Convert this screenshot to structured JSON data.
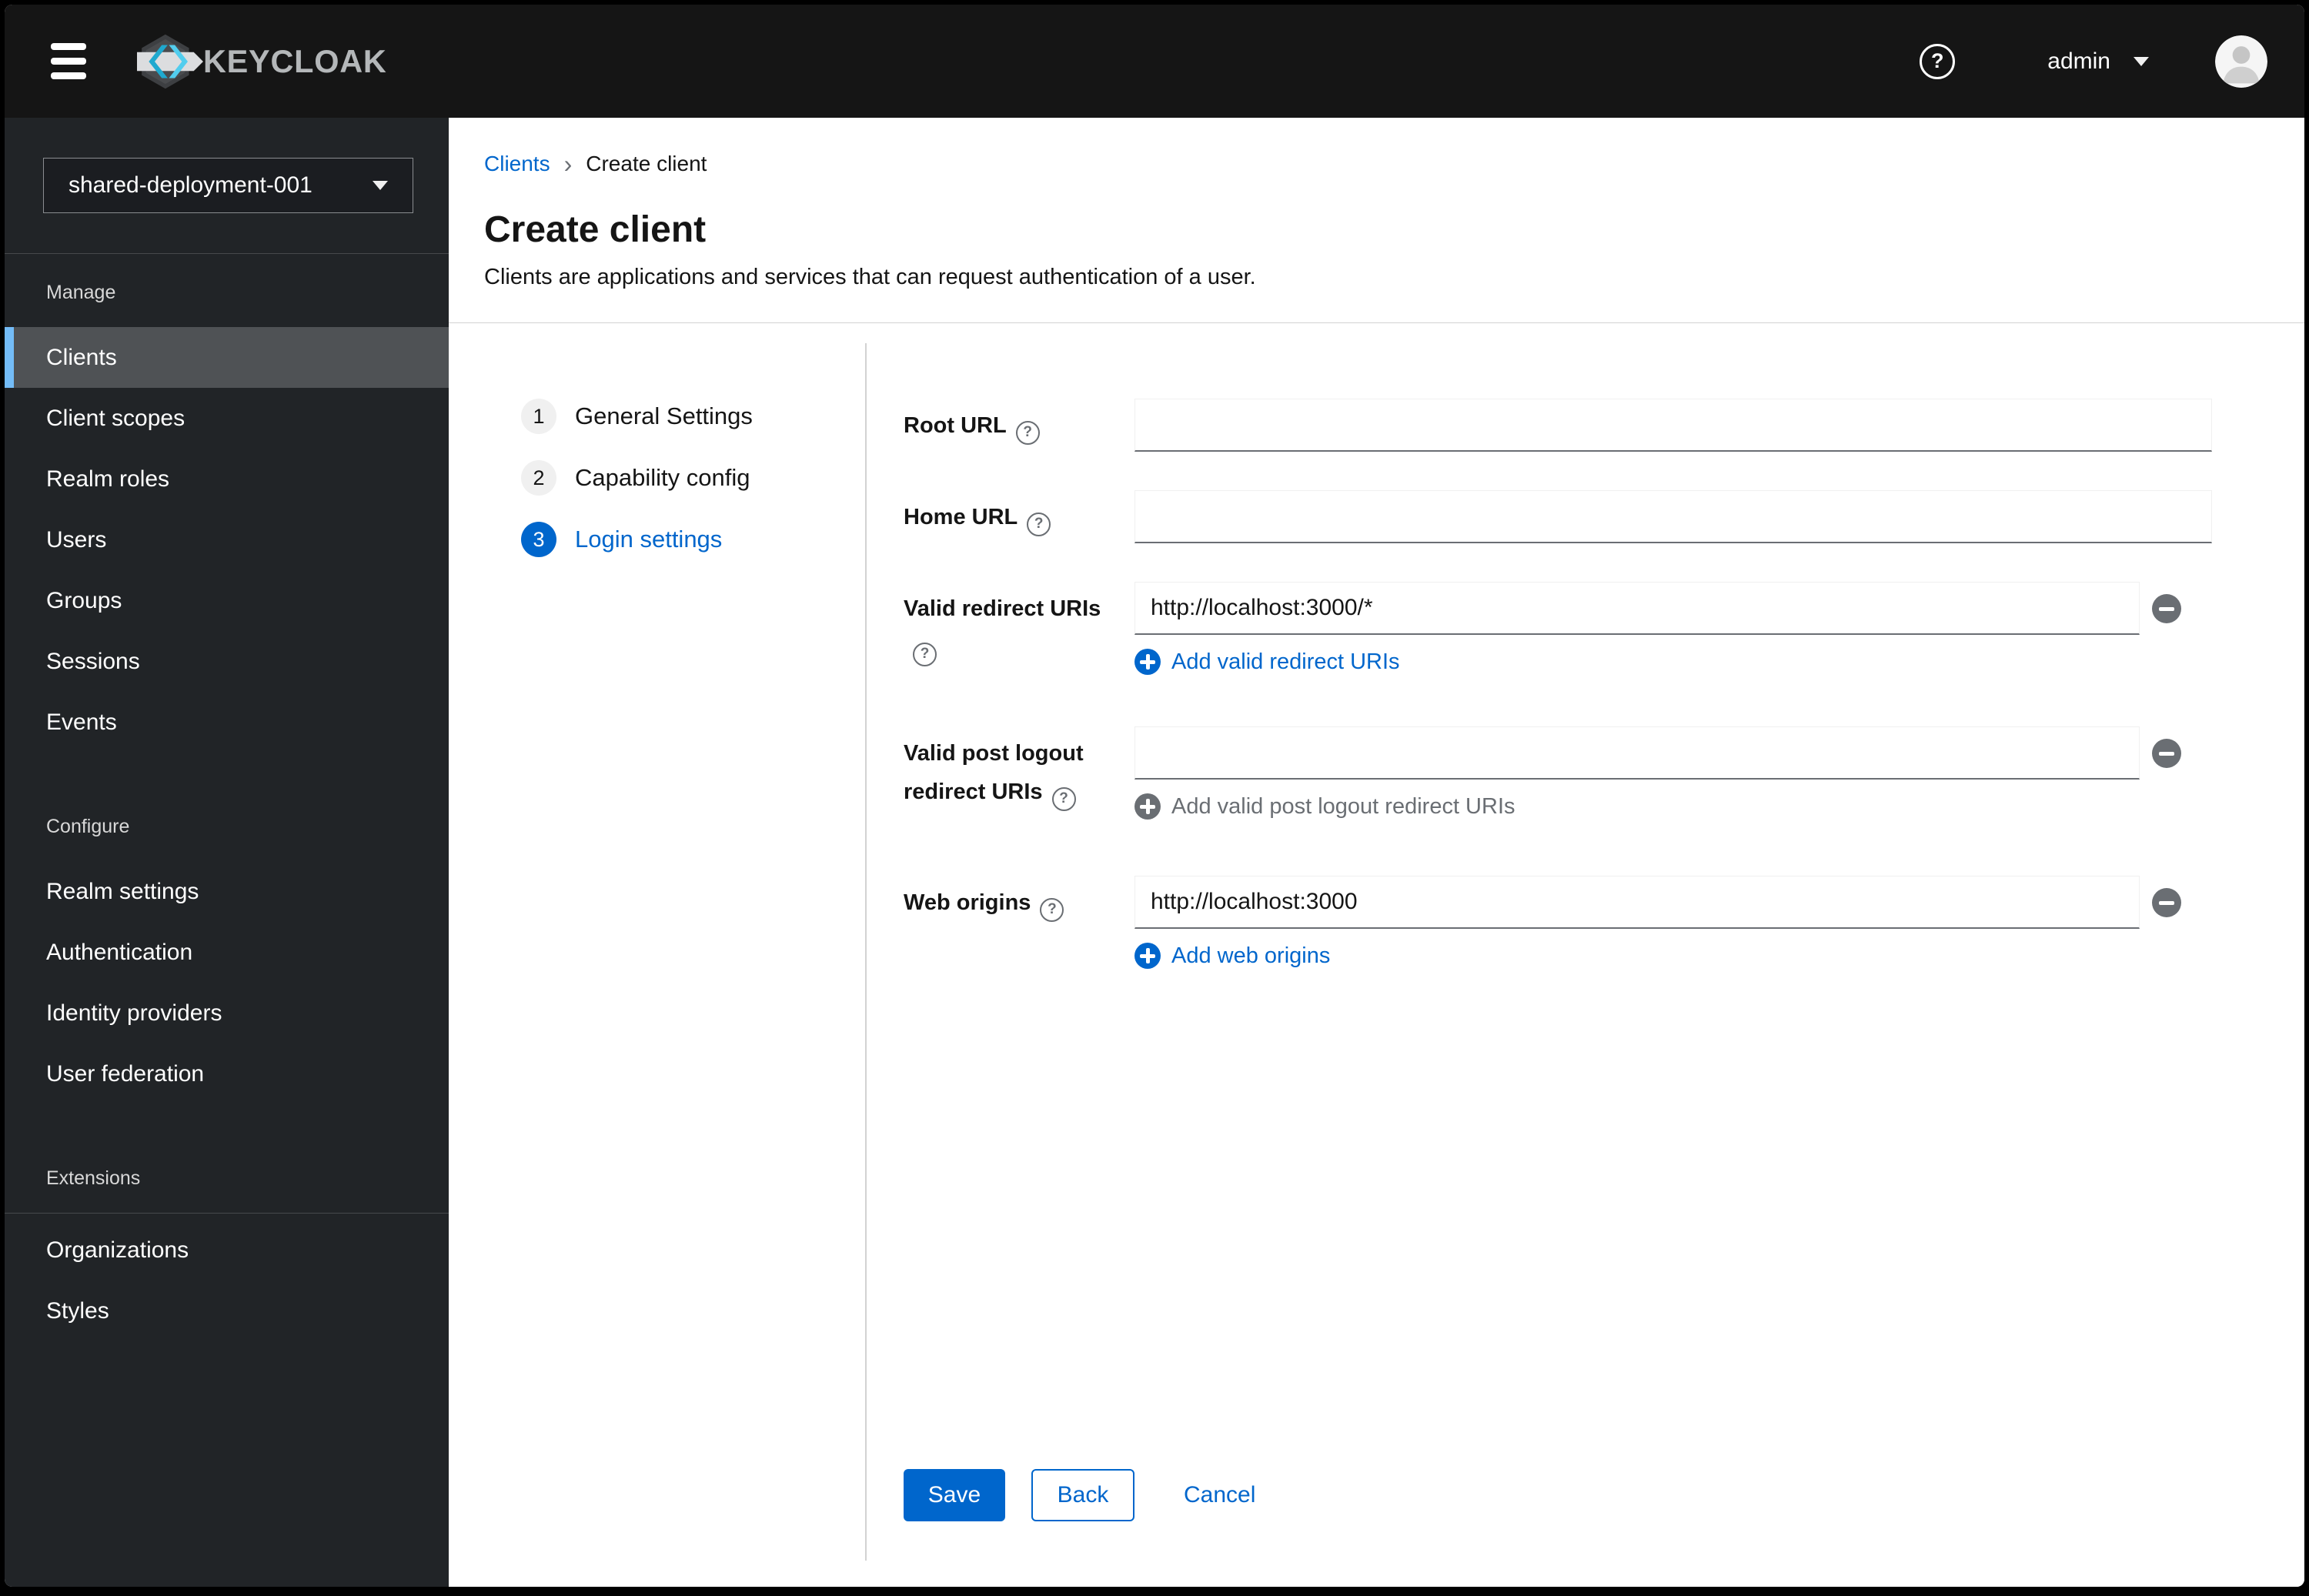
{
  "masthead": {
    "brand": "KEYCLOAK",
    "user": "admin"
  },
  "sidebar": {
    "realm": "shared-deployment-001",
    "sections": [
      {
        "title": "Manage",
        "items": [
          {
            "label": "Clients",
            "active": true
          },
          {
            "label": "Client scopes"
          },
          {
            "label": "Realm roles"
          },
          {
            "label": "Users"
          },
          {
            "label": "Groups"
          },
          {
            "label": "Sessions"
          },
          {
            "label": "Events"
          }
        ]
      },
      {
        "title": "Configure",
        "items": [
          {
            "label": "Realm settings"
          },
          {
            "label": "Authentication"
          },
          {
            "label": "Identity providers"
          },
          {
            "label": "User federation"
          }
        ]
      },
      {
        "title": "Extensions",
        "items": [
          {
            "label": "Organizations"
          },
          {
            "label": "Styles"
          }
        ]
      }
    ]
  },
  "breadcrumb": {
    "link": "Clients",
    "current": "Create client"
  },
  "page": {
    "title": "Create client",
    "subtitle": "Clients are applications and services that can request authentication of a user."
  },
  "wizard": {
    "steps": [
      {
        "number": "1",
        "label": "General Settings",
        "active": false
      },
      {
        "number": "2",
        "label": "Capability config",
        "active": false
      },
      {
        "number": "3",
        "label": "Login settings",
        "active": true
      }
    ]
  },
  "form": {
    "fields": [
      {
        "label": "Root URL",
        "value": ""
      },
      {
        "label": "Home URL",
        "value": ""
      },
      {
        "label": "Valid redirect URIs",
        "value": "http://localhost:3000/*",
        "add_label": "Add valid redirect URIs",
        "add_disabled": false
      },
      {
        "label": "Valid post logout redirect URIs",
        "value": "",
        "add_label": "Add valid post logout redirect URIs",
        "add_disabled": true
      },
      {
        "label": "Web origins",
        "value": "http://localhost:3000",
        "add_label": "Add web origins",
        "add_disabled": false
      }
    ],
    "actions": {
      "save": "Save",
      "back": "Back",
      "cancel": "Cancel"
    }
  },
  "icons": {
    "nav_toggle": "hamburger-icon",
    "help": "question-circle-icon",
    "user_caret": "chevron-down-icon",
    "avatar": "user-avatar-icon",
    "realm_caret": "chevron-down-icon",
    "breadcrumb_sep": "chevron-right-icon",
    "field_help": "question-circle-icon",
    "remove_row": "minus-circle-icon",
    "add_row": "plus-circle-icon"
  },
  "colors": {
    "primary_blue": "#0066cc",
    "masthead_bg": "#151515",
    "sidebar_bg": "#212427",
    "sidebar_selected_bg": "#4f5255",
    "sidebar_accent": "#73bcf7",
    "muted_gray": "#6a6e73",
    "divider_gray": "#d2d2d2",
    "logo_cyan": "#2ab1d4"
  }
}
